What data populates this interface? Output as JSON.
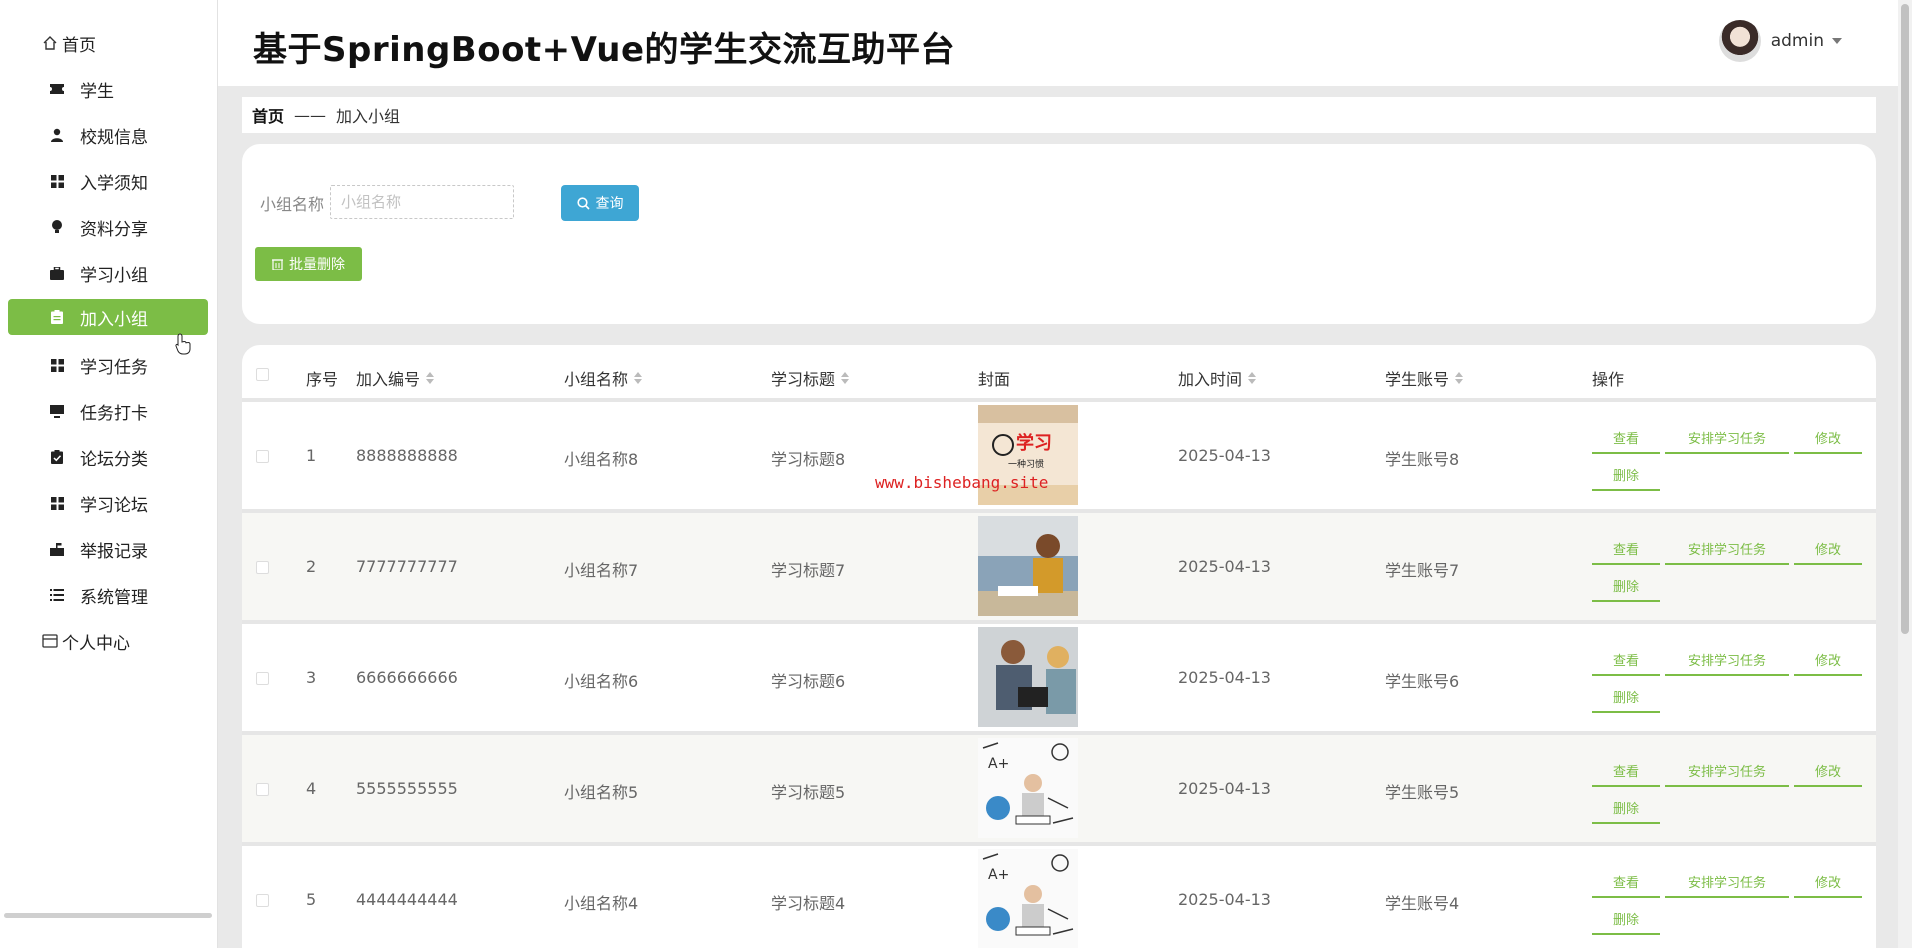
{
  "app": {
    "title": "基于SpringBoot+Vue的学生交流互助平台"
  },
  "user": {
    "name": "admin"
  },
  "sidebar": {
    "items": [
      {
        "label": "首页",
        "icon": "home-icon"
      },
      {
        "label": "学生",
        "icon": "ticket-icon"
      },
      {
        "label": "校规信息",
        "icon": "person-icon"
      },
      {
        "label": "入学须知",
        "icon": "grid-icon"
      },
      {
        "label": "资料分享",
        "icon": "bulb-icon"
      },
      {
        "label": "学习小组",
        "icon": "briefcase-icon"
      },
      {
        "label": "加入小组",
        "icon": "clipboard-icon",
        "active": true
      },
      {
        "label": "学习任务",
        "icon": "grid-icon"
      },
      {
        "label": "任务打卡",
        "icon": "monitor-icon"
      },
      {
        "label": "论坛分类",
        "icon": "checklist-icon"
      },
      {
        "label": "学习论坛",
        "icon": "grid-icon"
      },
      {
        "label": "举报记录",
        "icon": "mailbox-icon"
      },
      {
        "label": "系统管理",
        "icon": "list-icon"
      },
      {
        "label": "个人中心",
        "icon": "card-icon"
      }
    ]
  },
  "breadcrumb": {
    "home": "首页",
    "separator": "——",
    "current": "加入小组"
  },
  "search": {
    "label": "小组名称",
    "placeholder": "小组名称",
    "button": "查询",
    "batch_delete": "批量删除"
  },
  "table": {
    "headers": [
      "序号",
      "加入编号",
      "小组名称",
      "学习标题",
      "封面",
      "加入时间",
      "学生账号",
      "操作"
    ],
    "rows": [
      {
        "index": "1",
        "join_no": "8888888888",
        "group": "小组名称8",
        "title": "学习标题8",
        "time": "2025-04-13",
        "account": "学生账号8"
      },
      {
        "index": "2",
        "join_no": "7777777777",
        "group": "小组名称7",
        "title": "学习标题7",
        "time": "2025-04-13",
        "account": "学生账号7"
      },
      {
        "index": "3",
        "join_no": "6666666666",
        "group": "小组名称6",
        "title": "学习标题6",
        "time": "2025-04-13",
        "account": "学生账号6"
      },
      {
        "index": "4",
        "join_no": "5555555555",
        "group": "小组名称5",
        "title": "学习标题5",
        "time": "2025-04-13",
        "account": "学生账号5"
      },
      {
        "index": "5",
        "join_no": "4444444444",
        "group": "小组名称4",
        "title": "学习标题4",
        "time": "2025-04-13",
        "account": "学生账号4"
      }
    ],
    "actions": {
      "view": "查看",
      "assign": "安排学习任务",
      "edit": "修改",
      "delete": "删除"
    }
  },
  "cover1_text": {
    "main": "学习",
    "sub": "一种习惯"
  },
  "watermark": "www.bishebang.site",
  "colors": {
    "accent": "#7cbd46",
    "search_button": "#3ea6d4"
  }
}
